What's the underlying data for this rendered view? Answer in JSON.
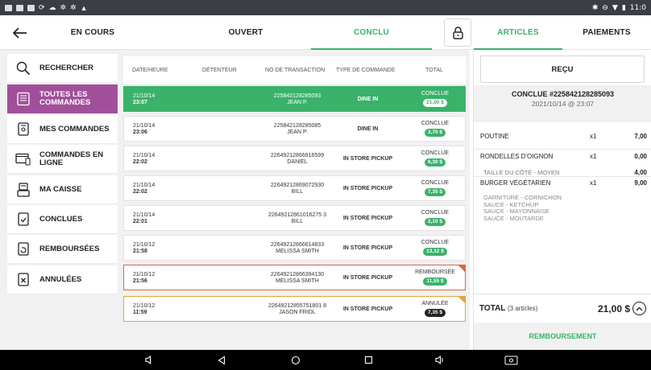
{
  "status_bar": {
    "time": "11:0"
  },
  "topbar": {
    "tabs": [
      {
        "label": "EN COURS",
        "active": false
      },
      {
        "label": "OUVERT",
        "active": false
      },
      {
        "label": "CONCLU",
        "active": true
      }
    ],
    "right_tabs": [
      {
        "label": "ARTICLES",
        "active": true
      },
      {
        "label": "PAIEMENTS",
        "active": false
      }
    ]
  },
  "sidebar": {
    "items": [
      {
        "label": "RECHERCHER",
        "icon": "search-icon"
      },
      {
        "label": "TOUTES LES COMMANDES",
        "icon": "all-orders-icon",
        "active": true
      },
      {
        "label": "MES COMMANDES",
        "icon": "my-orders-icon"
      },
      {
        "label": "COMMANDES EN LIGNE",
        "icon": "online-orders-icon"
      },
      {
        "label": "MA CAISSE",
        "icon": "register-icon"
      },
      {
        "label": "CONCLUES",
        "icon": "concluded-icon"
      },
      {
        "label": "REMBOURSÉES",
        "icon": "refunded-icon"
      },
      {
        "label": "ANNULÉES",
        "icon": "cancelled-icon"
      }
    ]
  },
  "table": {
    "headers": [
      "DATE/HEURE",
      "DÉTENTEUR",
      "NO DE TRANSACTION",
      "TYPE DE COMMANDE",
      "TOTAL"
    ],
    "rows": [
      {
        "date": "21/10/14",
        "time": "23:07",
        "tx": "225842128285093",
        "holder": "JEAN P.",
        "type": "DINE IN",
        "status": "CONCLUE",
        "total": "21,00 $",
        "kind": "selected"
      },
      {
        "date": "21/10/14",
        "time": "23:06",
        "tx": "225842128285085",
        "holder": "JEAN P.",
        "type": "DINE IN",
        "status": "CONCLUE",
        "total": "3,70 $",
        "kind": "normal"
      },
      {
        "date": "21/10/14",
        "time": "22:02",
        "tx": "22649212866916599",
        "holder": "DANIEL",
        "type": "IN STORE PICKUP",
        "status": "CONCLUE",
        "total": "6,30 $",
        "kind": "normal"
      },
      {
        "date": "21/10/14",
        "time": "22:02",
        "tx": "22649212869072930",
        "holder": "BILL",
        "type": "IN STORE PICKUP",
        "status": "CONCLUE",
        "total": "7,35 $",
        "kind": "normal"
      },
      {
        "date": "21/10/14",
        "time": "22:01",
        "tx": "22649212861016275 3",
        "holder": "BILL",
        "type": "IN STORE PICKUP",
        "status": "CONCLUE",
        "total": "2,10 $",
        "kind": "normal"
      },
      {
        "date": "21/10/12",
        "time": "21:58",
        "tx": "22649212866614833",
        "holder": "MELISSA SMITH",
        "type": "IN STORE PICKUP",
        "status": "CONCLUE",
        "total": "13,12 $",
        "kind": "normal"
      },
      {
        "date": "21/10/12",
        "time": "21:56",
        "tx": "22649212866394130",
        "holder": "MELISSA SMITH",
        "type": "IN STORE PICKUP",
        "status": "REMBOURSÉE",
        "total": "11,55 $",
        "kind": "refund"
      },
      {
        "date": "21/10/12",
        "time": "11:59",
        "tx": "22649212855751801 8",
        "holder": "JASON FRIDL",
        "type": "IN STORE PICKUP",
        "status": "ANNULÉE",
        "total": "7,35 $",
        "kind": "cancel"
      }
    ]
  },
  "receipt": {
    "button": "REÇU",
    "title": "CONCLUE #225842128285093",
    "datetime": "2021/10/14 @ 23:07",
    "items": [
      {
        "name": "POUTINE",
        "qty": "x1",
        "price": "7,00"
      },
      {
        "name": "RONDELLES D'OIGNON",
        "qty": "x1",
        "price": "0,00"
      },
      {
        "name": "TAILLE DU CÔTÉ - MOYEN",
        "qty": "",
        "price": "4,00"
      },
      {
        "name": "BURGER VÉGÉTARIEN",
        "qty": "x1",
        "price": "9,00"
      }
    ],
    "modifiers": [
      "GARNITURE - CORNICHON",
      "SAUCE - KETCHUP",
      "SAUCE - MAYONNAISE",
      "SAUCE - MOUTARDE"
    ],
    "total_label": "TOTAL",
    "total_count": "(3 articles)",
    "total_value": "21,00 $",
    "refund_button": "REMBOURSEMENT"
  },
  "colors": {
    "accent": "#3ab26a",
    "purple": "#a24f9b",
    "refund": "#d56a3a",
    "cancel": "#e0a63a"
  }
}
